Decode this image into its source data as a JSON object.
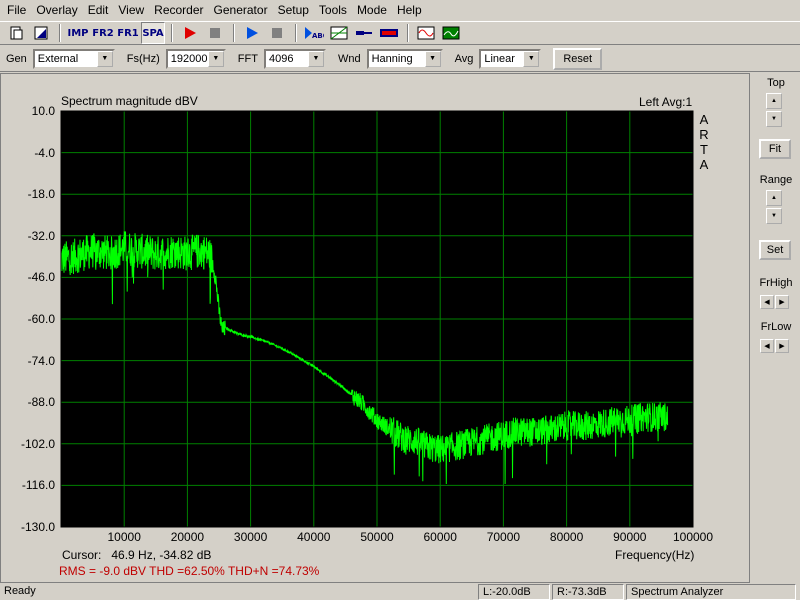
{
  "menu": [
    "File",
    "Overlay",
    "Edit",
    "View",
    "Recorder",
    "Generator",
    "Setup",
    "Tools",
    "Mode",
    "Help"
  ],
  "toolbar": {
    "imp": "IMP",
    "fr2": "FR2",
    "fr1": "FR1",
    "spa": "SPA"
  },
  "settings": {
    "gen_label": "Gen",
    "gen_value": "External",
    "fs_label": "Fs(Hz)",
    "fs_value": "192000",
    "fft_label": "FFT",
    "fft_value": "4096",
    "wnd_label": "Wnd",
    "wnd_value": "Hanning",
    "avg_label": "Avg",
    "avg_value": "Linear",
    "reset_label": "Reset"
  },
  "plot": {
    "title": "Spectrum magnitude dBV",
    "right_info": "Left Avg:1",
    "brand": [
      "A",
      "R",
      "T",
      "A"
    ],
    "xlabel": "Frequency(Hz)",
    "cursor_label": "Cursor:",
    "cursor_value": "46.9 Hz, -34.82 dB",
    "stats": "RMS =   -9.0 dBV    THD =62.50%    THD+N =74.73%",
    "trace_color": "#00ff00",
    "background": "#000000",
    "grid_color": "#008000"
  },
  "chart_data": {
    "type": "line",
    "title": "Spectrum magnitude dBV",
    "xlabel": "Frequency(Hz)",
    "ylabel": "",
    "xlim": [
      0,
      100000
    ],
    "ylim": [
      -130,
      10
    ],
    "x_ticks": [
      "10000",
      "20000",
      "30000",
      "40000",
      "50000",
      "60000",
      "70000",
      "80000",
      "90000",
      "100000"
    ],
    "y_ticks": [
      "10.0",
      "-4.0",
      "-18.0",
      "-32.0",
      "-46.0",
      "-60.0",
      "-74.0",
      "-88.0",
      "-102.0",
      "-116.0",
      "-130.0"
    ],
    "grid": true,
    "series": [
      {
        "x": [
          0,
          2000,
          5000,
          8000,
          10000,
          12000,
          15000,
          18000,
          20000,
          22000,
          23500,
          24000,
          24500,
          25000,
          25500,
          26000,
          28000,
          30000,
          33000,
          36000,
          40000,
          44000,
          48000,
          50000,
          52000,
          54000,
          56000,
          58000,
          60000,
          62000,
          64000,
          66000,
          68000,
          70000,
          72000,
          75000,
          78000,
          80000,
          83000,
          86000,
          88000,
          90000,
          92000,
          94000,
          96000
        ],
        "values": [
          -40,
          -39,
          -37,
          -38,
          -36,
          -37,
          -38,
          -37,
          -38,
          -37,
          -38,
          -41,
          -47,
          -57,
          -64,
          -63,
          -65,
          -66,
          -68,
          -71,
          -76,
          -82,
          -89,
          -94,
          -97,
          -100,
          -101,
          -103,
          -104,
          -103,
          -102,
          -101,
          -100,
          -99,
          -98,
          -98,
          -97,
          -96,
          -96,
          -95,
          -94,
          -94,
          -93,
          -93,
          -93
        ]
      }
    ]
  },
  "right_panel": {
    "top_label": "Top",
    "fit_label": "Fit",
    "range_label": "Range",
    "set_label": "Set",
    "frhigh_label": "FrHigh",
    "frlow_label": "FrLow"
  },
  "status": {
    "ready": "Ready",
    "left": "L:-20.0dB",
    "right": "R:-73.3dB",
    "mode": "Spectrum Analyzer"
  }
}
